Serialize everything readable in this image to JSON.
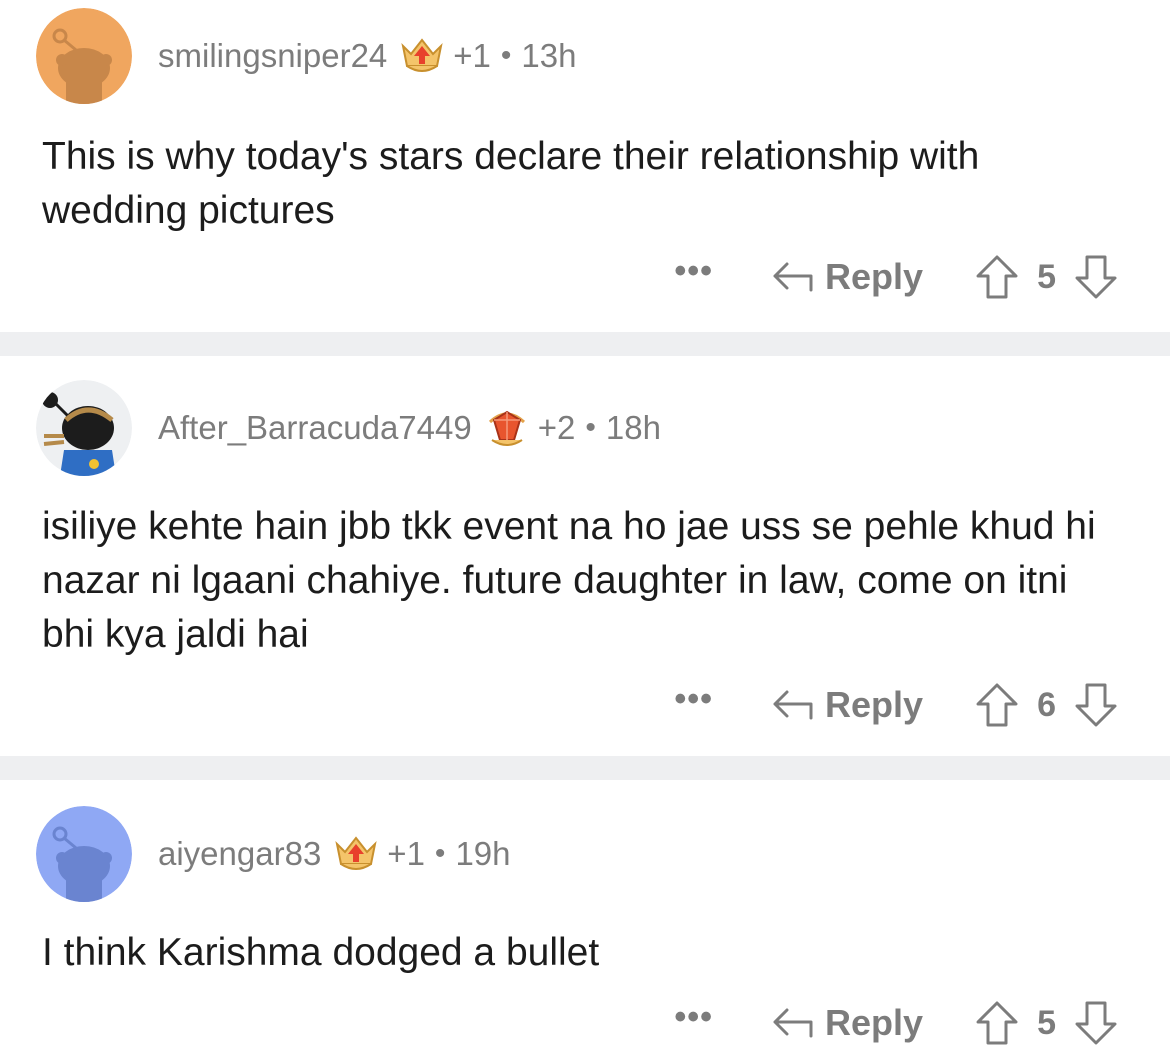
{
  "comments": [
    {
      "username": "smilingsniper24",
      "karma": "+1",
      "separator": "•",
      "age": "13h",
      "text": "This is why today's stars declare their relationship with wedding pictures",
      "more": "•••",
      "reply_label": "Reply",
      "score": "5",
      "avatar_color": "#f0a65f",
      "flair_icon": "trophy-badge-icon"
    },
    {
      "username": "After_Barracuda7449",
      "karma": "+2",
      "separator": "•",
      "age": "18h",
      "text": "isiliye kehte hain jbb tkk event na ho jae uss se pehle khud hi nazar ni lgaani chahiye. future daughter in law, come on itni bhi kya jaldi hai",
      "more": "•••",
      "reply_label": "Reply",
      "score": "6",
      "avatar_color": "#eef0f2",
      "flair_icon": "crystal-badge-icon"
    },
    {
      "username": "aiyengar83",
      "karma": "+1",
      "separator": "•",
      "age": "19h",
      "text": "I think Karishma dodged a bullet",
      "more": "•••",
      "reply_label": "Reply",
      "score": "5",
      "avatar_color": "#8fa8f4",
      "flair_icon": "trophy-badge-icon"
    }
  ],
  "colors": {
    "meta_text": "#7c7c7c",
    "body_text": "#1c1c1c",
    "divider": "#eeeff1"
  }
}
